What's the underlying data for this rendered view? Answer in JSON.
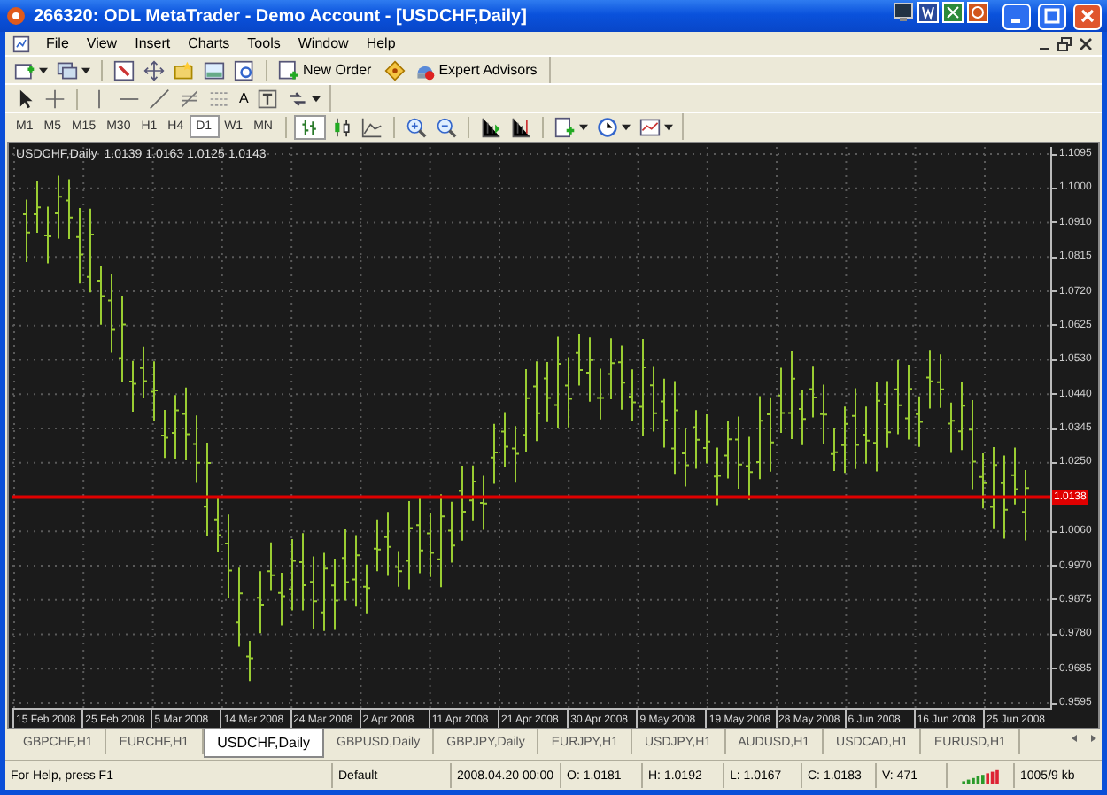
{
  "window": {
    "title": "266320: ODL MetaTrader - Demo Account - [USDCHF,Daily]"
  },
  "menu": [
    "File",
    "View",
    "Insert",
    "Charts",
    "Tools",
    "Window",
    "Help"
  ],
  "toolbar": {
    "new_order": "New Order",
    "expert_advisors": "Expert Advisors"
  },
  "drawing_tools": {
    "text_tool": "A"
  },
  "timeframes": [
    {
      "label": "M1",
      "selected": false
    },
    {
      "label": "M5",
      "selected": false
    },
    {
      "label": "M15",
      "selected": false
    },
    {
      "label": "M30",
      "selected": false
    },
    {
      "label": "H1",
      "selected": false
    },
    {
      "label": "H4",
      "selected": false
    },
    {
      "label": "D1",
      "selected": true
    },
    {
      "label": "W1",
      "selected": false
    },
    {
      "label": "MN",
      "selected": false
    }
  ],
  "chart": {
    "header": "USDCHF,Daily  1.0139 1.0163 1.0125 1.0143",
    "price_scale": [
      {
        "text": "1.1095",
        "kind": "tick"
      },
      {
        "text": "1.1000",
        "kind": "tick"
      },
      {
        "text": "1.0910",
        "kind": "tick"
      },
      {
        "text": "1.0815",
        "kind": "tick"
      },
      {
        "text": "1.0720",
        "kind": "tick"
      },
      {
        "text": "1.0625",
        "kind": "tick"
      },
      {
        "text": "1.0530",
        "kind": "tick"
      },
      {
        "text": "1.0440",
        "kind": "tick"
      },
      {
        "text": "1.0345",
        "kind": "tick"
      },
      {
        "text": "1.0250",
        "kind": "tick"
      },
      {
        "text": "1.0138",
        "kind": "current"
      },
      {
        "text": "1.0060",
        "kind": "tick"
      },
      {
        "text": "0.9970",
        "kind": "tick"
      },
      {
        "text": "0.9875",
        "kind": "tick"
      },
      {
        "text": "0.9780",
        "kind": "tick"
      },
      {
        "text": "0.9685",
        "kind": "tick"
      },
      {
        "text": "0.9595",
        "kind": "tick"
      }
    ],
    "time_axis": [
      "15 Feb 2008",
      "25 Feb 2008",
      "5 Mar 2008",
      "14 Mar 2008",
      "24 Mar 2008",
      "2 Apr 2008",
      "11 Apr 2008",
      "21 Apr 2008",
      "30 Apr 2008",
      "9 May 2008",
      "19 May 2008",
      "28 May 2008",
      "6 Jun 2008",
      "16 Jun 2008",
      "25 Jun 2008"
    ]
  },
  "tabs": [
    {
      "label": "GBPCHF,H1",
      "selected": false
    },
    {
      "label": "EURCHF,H1",
      "selected": false
    },
    {
      "label": "USDCHF,Daily",
      "selected": true
    },
    {
      "label": "GBPUSD,Daily",
      "selected": false
    },
    {
      "label": "GBPJPY,Daily",
      "selected": false
    },
    {
      "label": "EURJPY,H1",
      "selected": false
    },
    {
      "label": "USDJPY,H1",
      "selected": false
    },
    {
      "label": "AUDUSD,H1",
      "selected": false
    },
    {
      "label": "USDCAD,H1",
      "selected": false
    },
    {
      "label": "EURUSD,H1",
      "selected": false
    }
  ],
  "status_bar": {
    "help": "For Help, press F1",
    "profile": "Default",
    "time": "2008.04.20 00:00",
    "open": "O: 1.0181",
    "high": "H: 1.0192",
    "low": "L: 1.0167",
    "close": "C: 1.0183",
    "volume": "V: 471",
    "traffic": "1005/9 kb"
  }
}
